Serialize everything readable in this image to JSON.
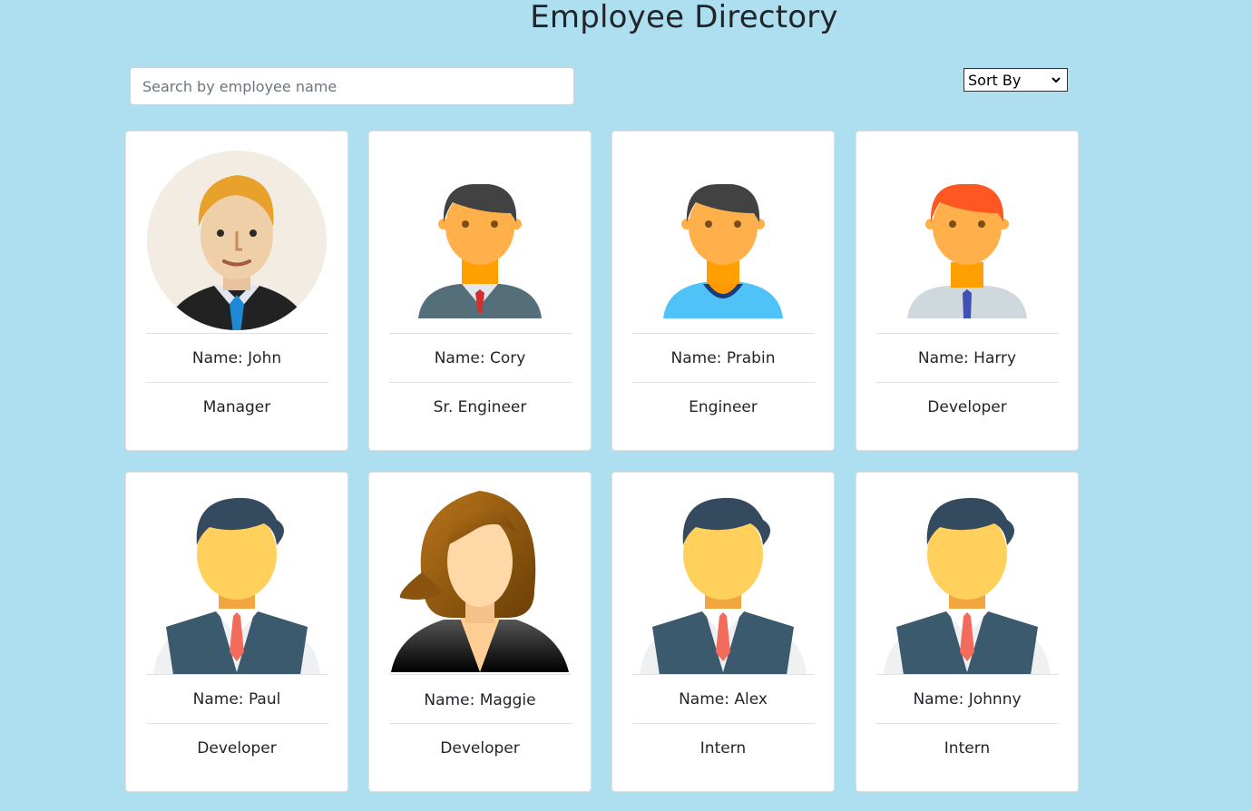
{
  "header": {
    "title": "Employee Directory"
  },
  "search": {
    "placeholder": "Search by employee name"
  },
  "sort": {
    "selected": "Sort By"
  },
  "employees": [
    {
      "name": "Name: John",
      "role": "Manager",
      "avatar": "manager-avatar-icon"
    },
    {
      "name": "Name: Cory",
      "role": "Sr. Engineer",
      "avatar": "man-gray-suit-avatar-icon"
    },
    {
      "name": "Name: Prabin",
      "role": "Engineer",
      "avatar": "man-blue-shirt-avatar-icon"
    },
    {
      "name": "Name: Harry",
      "role": "Developer",
      "avatar": "man-red-hair-avatar-icon"
    },
    {
      "name": "Name: Paul",
      "role": "Developer",
      "avatar": "man-vest-avatar-icon"
    },
    {
      "name": "Name: Maggie",
      "role": "Developer",
      "avatar": "woman-avatar-icon"
    },
    {
      "name": "Name: Alex",
      "role": "Intern",
      "avatar": "man-vest-avatar-icon"
    },
    {
      "name": "Name: Johnny",
      "role": "Intern",
      "avatar": "man-vest-avatar-icon"
    }
  ],
  "colors": {
    "background": "#addff0",
    "card": "#ffffff",
    "text": "#212529"
  }
}
